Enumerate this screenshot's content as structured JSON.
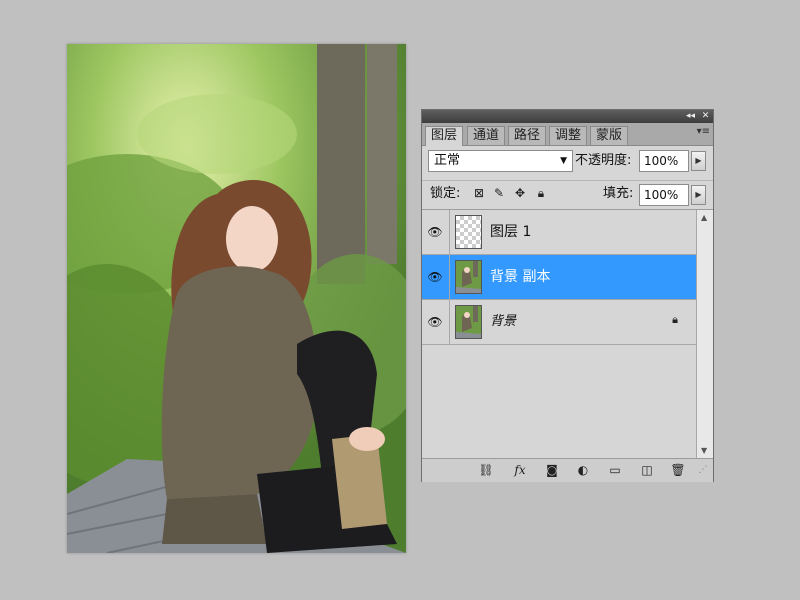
{
  "panel": {
    "titlebar": {
      "collapse_glyph": "◂◂",
      "close_glyph": "✕"
    },
    "tabs": [
      {
        "label": "图层",
        "active": true
      },
      {
        "label": "通道",
        "active": false
      },
      {
        "label": "路径",
        "active": false
      },
      {
        "label": "调整",
        "active": false
      },
      {
        "label": "蒙版",
        "active": false
      }
    ],
    "menu_glyph": "▾≡",
    "blend_mode": "正常",
    "opacity_label": "不透明度:",
    "opacity_value": "100%",
    "lock_label": "锁定:",
    "fill_label": "填充:",
    "fill_value": "100%",
    "layers": [
      {
        "name": "图层 1",
        "selected": false,
        "thumb": "transparent",
        "locked": false
      },
      {
        "name": "背景 副本",
        "selected": true,
        "thumb": "photo",
        "locked": false
      },
      {
        "name": "背景",
        "selected": false,
        "thumb": "photo",
        "locked": true
      }
    ],
    "bottom_icons": [
      "link-icon",
      "fx-icon",
      "mask-icon",
      "adjustment-icon",
      "group-folder-icon",
      "new-layer-icon",
      "trash-icon"
    ]
  },
  "colors": {
    "selected": "#3399ff",
    "panel_bg": "#d6d6d6",
    "workspace_bg": "#c0c0c0"
  }
}
